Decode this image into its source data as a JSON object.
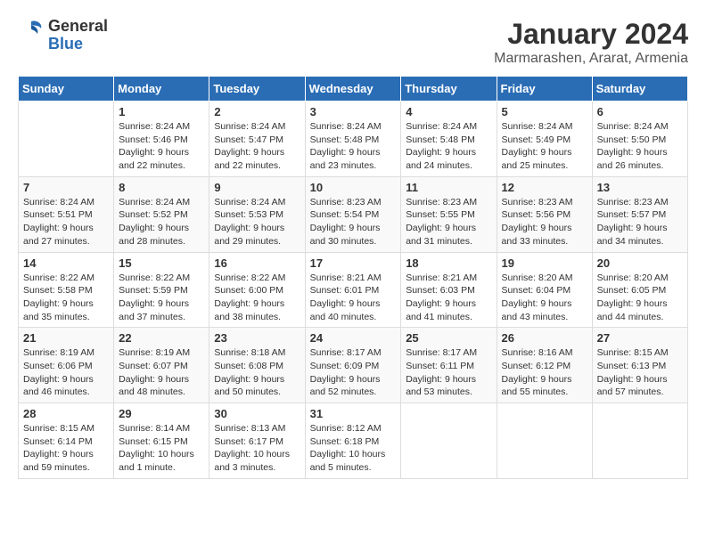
{
  "header": {
    "logo_general": "General",
    "logo_blue": "Blue",
    "title": "January 2024",
    "subtitle": "Marmarashen, Ararat, Armenia"
  },
  "days_of_week": [
    "Sunday",
    "Monday",
    "Tuesday",
    "Wednesday",
    "Thursday",
    "Friday",
    "Saturday"
  ],
  "weeks": [
    [
      {
        "day": "",
        "info": ""
      },
      {
        "day": "1",
        "info": "Sunrise: 8:24 AM\nSunset: 5:46 PM\nDaylight: 9 hours\nand 22 minutes."
      },
      {
        "day": "2",
        "info": "Sunrise: 8:24 AM\nSunset: 5:47 PM\nDaylight: 9 hours\nand 22 minutes."
      },
      {
        "day": "3",
        "info": "Sunrise: 8:24 AM\nSunset: 5:48 PM\nDaylight: 9 hours\nand 23 minutes."
      },
      {
        "day": "4",
        "info": "Sunrise: 8:24 AM\nSunset: 5:48 PM\nDaylight: 9 hours\nand 24 minutes."
      },
      {
        "day": "5",
        "info": "Sunrise: 8:24 AM\nSunset: 5:49 PM\nDaylight: 9 hours\nand 25 minutes."
      },
      {
        "day": "6",
        "info": "Sunrise: 8:24 AM\nSunset: 5:50 PM\nDaylight: 9 hours\nand 26 minutes."
      }
    ],
    [
      {
        "day": "7",
        "info": "Sunrise: 8:24 AM\nSunset: 5:51 PM\nDaylight: 9 hours\nand 27 minutes."
      },
      {
        "day": "8",
        "info": "Sunrise: 8:24 AM\nSunset: 5:52 PM\nDaylight: 9 hours\nand 28 minutes."
      },
      {
        "day": "9",
        "info": "Sunrise: 8:24 AM\nSunset: 5:53 PM\nDaylight: 9 hours\nand 29 minutes."
      },
      {
        "day": "10",
        "info": "Sunrise: 8:23 AM\nSunset: 5:54 PM\nDaylight: 9 hours\nand 30 minutes."
      },
      {
        "day": "11",
        "info": "Sunrise: 8:23 AM\nSunset: 5:55 PM\nDaylight: 9 hours\nand 31 minutes."
      },
      {
        "day": "12",
        "info": "Sunrise: 8:23 AM\nSunset: 5:56 PM\nDaylight: 9 hours\nand 33 minutes."
      },
      {
        "day": "13",
        "info": "Sunrise: 8:23 AM\nSunset: 5:57 PM\nDaylight: 9 hours\nand 34 minutes."
      }
    ],
    [
      {
        "day": "14",
        "info": "Sunrise: 8:22 AM\nSunset: 5:58 PM\nDaylight: 9 hours\nand 35 minutes."
      },
      {
        "day": "15",
        "info": "Sunrise: 8:22 AM\nSunset: 5:59 PM\nDaylight: 9 hours\nand 37 minutes."
      },
      {
        "day": "16",
        "info": "Sunrise: 8:22 AM\nSunset: 6:00 PM\nDaylight: 9 hours\nand 38 minutes."
      },
      {
        "day": "17",
        "info": "Sunrise: 8:21 AM\nSunset: 6:01 PM\nDaylight: 9 hours\nand 40 minutes."
      },
      {
        "day": "18",
        "info": "Sunrise: 8:21 AM\nSunset: 6:03 PM\nDaylight: 9 hours\nand 41 minutes."
      },
      {
        "day": "19",
        "info": "Sunrise: 8:20 AM\nSunset: 6:04 PM\nDaylight: 9 hours\nand 43 minutes."
      },
      {
        "day": "20",
        "info": "Sunrise: 8:20 AM\nSunset: 6:05 PM\nDaylight: 9 hours\nand 44 minutes."
      }
    ],
    [
      {
        "day": "21",
        "info": "Sunrise: 8:19 AM\nSunset: 6:06 PM\nDaylight: 9 hours\nand 46 minutes."
      },
      {
        "day": "22",
        "info": "Sunrise: 8:19 AM\nSunset: 6:07 PM\nDaylight: 9 hours\nand 48 minutes."
      },
      {
        "day": "23",
        "info": "Sunrise: 8:18 AM\nSunset: 6:08 PM\nDaylight: 9 hours\nand 50 minutes."
      },
      {
        "day": "24",
        "info": "Sunrise: 8:17 AM\nSunset: 6:09 PM\nDaylight: 9 hours\nand 52 minutes."
      },
      {
        "day": "25",
        "info": "Sunrise: 8:17 AM\nSunset: 6:11 PM\nDaylight: 9 hours\nand 53 minutes."
      },
      {
        "day": "26",
        "info": "Sunrise: 8:16 AM\nSunset: 6:12 PM\nDaylight: 9 hours\nand 55 minutes."
      },
      {
        "day": "27",
        "info": "Sunrise: 8:15 AM\nSunset: 6:13 PM\nDaylight: 9 hours\nand 57 minutes."
      }
    ],
    [
      {
        "day": "28",
        "info": "Sunrise: 8:15 AM\nSunset: 6:14 PM\nDaylight: 9 hours\nand 59 minutes."
      },
      {
        "day": "29",
        "info": "Sunrise: 8:14 AM\nSunset: 6:15 PM\nDaylight: 10 hours\nand 1 minute."
      },
      {
        "day": "30",
        "info": "Sunrise: 8:13 AM\nSunset: 6:17 PM\nDaylight: 10 hours\nand 3 minutes."
      },
      {
        "day": "31",
        "info": "Sunrise: 8:12 AM\nSunset: 6:18 PM\nDaylight: 10 hours\nand 5 minutes."
      },
      {
        "day": "",
        "info": ""
      },
      {
        "day": "",
        "info": ""
      },
      {
        "day": "",
        "info": ""
      }
    ]
  ]
}
